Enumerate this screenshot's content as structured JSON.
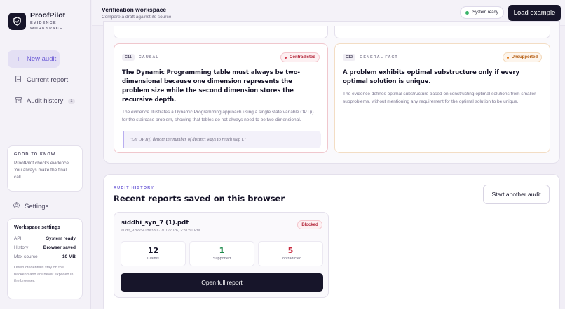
{
  "brand": {
    "name": "ProofPilot",
    "subtitle": "EVIDENCE WORKSPACE"
  },
  "nav": {
    "new_audit": "New audit",
    "current_report": "Current report",
    "audit_history": "Audit history",
    "audit_history_count": "1",
    "settings": "Settings"
  },
  "good_to_know": {
    "title": "GOOD TO KNOW",
    "text": "ProofPilot checks evidence. You always make the final call."
  },
  "workspace_settings": {
    "title": "Workspace settings",
    "rows": [
      {
        "label": "API",
        "value": "System ready"
      },
      {
        "label": "History",
        "value": "Browser saved"
      },
      {
        "label": "Max source",
        "value": "10 MB"
      }
    ],
    "note": "Owen credentials stay on the backend and are never exposed in the browser."
  },
  "header": {
    "title": "Verification workspace",
    "subtitle": "Compare a draft against its source",
    "status": "System ready",
    "load_example": "Load example"
  },
  "claims": [
    {
      "id": "C11",
      "type": "CAUSAL",
      "status": "Contradicted",
      "claim": "The Dynamic Programming table must always be two-dimensional because one dimension represents the problem size while the second dimension stores the recursive depth.",
      "explanation": "The evidence illustrates a Dynamic Programming approach using a single state variable OPT(i) for the staircase problem, showing that tables do not always need to be two-dimensional.",
      "quote": "\"Let OPT(i) denote the number of distinct ways to reach step i.\""
    },
    {
      "id": "C12",
      "type": "GENERAL FACT",
      "status": "Unsupported",
      "claim": "A problem exhibits optimal substructure only if every optimal solution is unique.",
      "explanation": "The evidence defines optimal substructure based on constructing optimal solutions from smaller subproblems, without mentioning any requirement for the optimal solution to be unique."
    }
  ],
  "history": {
    "eyebrow": "AUDIT HISTORY",
    "heading": "Recent reports saved on this browser",
    "another_button": "Start another audit",
    "report": {
      "file": "siddhi_syn_7 (1).pdf",
      "meta": "audit_9265541de330 · 7/10/2026, 2:31:51 PM",
      "badge": "Blocked",
      "stats": [
        {
          "value": "12",
          "label": "Claims",
          "color": "#17152a"
        },
        {
          "value": "1",
          "label": "Supported",
          "color": "#1e8a4c"
        },
        {
          "value": "5",
          "label": "Contradicted",
          "color": "#c8293f"
        }
      ],
      "open_button": "Open full report"
    }
  }
}
